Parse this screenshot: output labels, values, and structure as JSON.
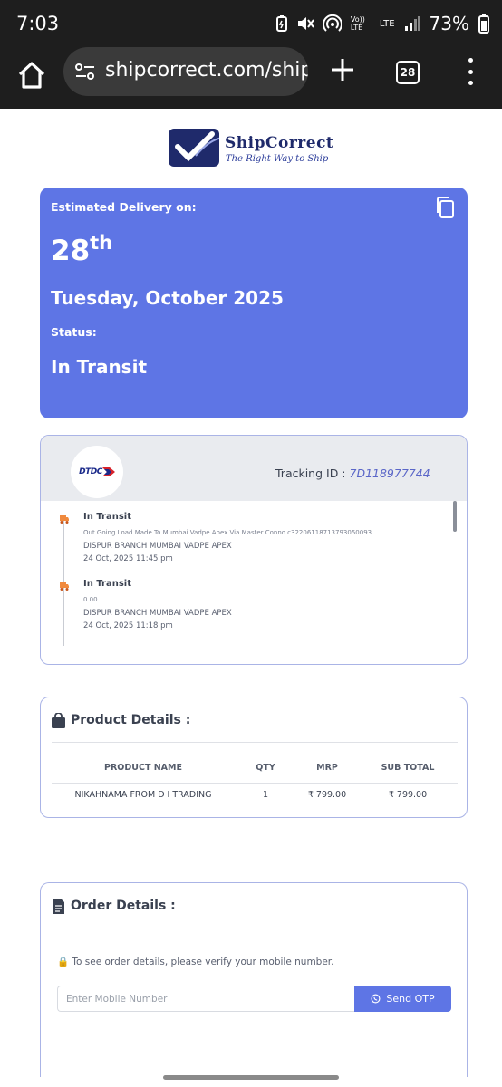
{
  "status_bar": {
    "time": "7:03",
    "battery": "73%",
    "volte": "Vo)) LTE",
    "lte": "LTE"
  },
  "browser": {
    "url": "shipcorrect.com/ship",
    "tab_count": "28"
  },
  "logo": {
    "name": "ShipCorrect",
    "tagline": "The Right Way to Ship"
  },
  "delivery": {
    "label": "Estimated Delivery on:",
    "day": "28",
    "day_suffix": "th",
    "date": "Tuesday, October 2025",
    "status_label": "Status:",
    "status": "In Transit",
    "color": "#5e75e5"
  },
  "tracking": {
    "courier_logo_text": "DTDC",
    "id_label": "Tracking ID :",
    "id_value": "7D118977744",
    "events": [
      {
        "title": "In Transit",
        "desc": "Out Going Load Made To Mumbai Vadpe Apex Via Master Conno.c32206118713793050093",
        "location": "DISPUR BRANCH MUMBAI VADPE APEX",
        "time": "24 Oct, 2025 11:45 pm"
      },
      {
        "title": "In Transit",
        "desc": "0.00",
        "location": "DISPUR BRANCH MUMBAI VADPE APEX",
        "time": "24 Oct, 2025 11:18 pm"
      }
    ]
  },
  "product": {
    "title": "Product Details :",
    "headers": [
      "PRODUCT NAME",
      "QTY",
      "MRP",
      "SUB TOTAL"
    ],
    "rows": [
      [
        "NIKAHNAMA FROM D I TRADING",
        "1",
        "₹ 799.00",
        "₹ 799.00"
      ]
    ]
  },
  "order": {
    "title": "Order Details :",
    "verify_text": "🔒 To see order details, please verify your mobile number.",
    "mobile_placeholder": "Enter Mobile Number",
    "otp_label": "Send OTP"
  }
}
